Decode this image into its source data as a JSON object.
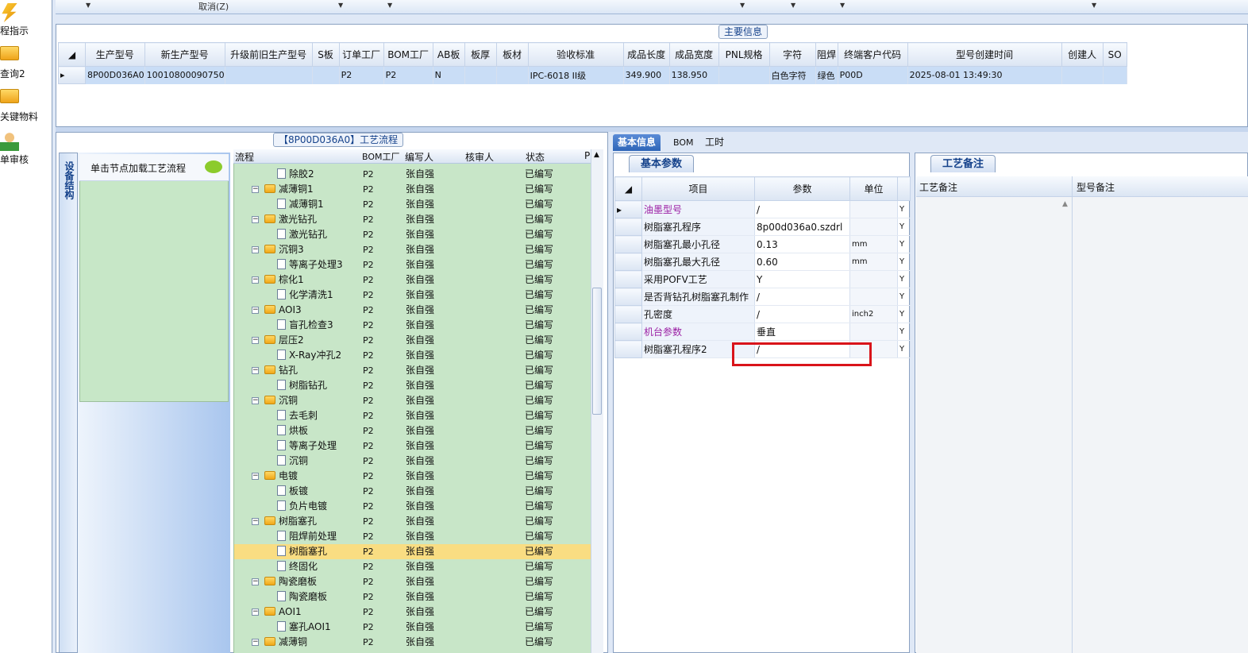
{
  "left_nav": [
    {
      "label": "程指示",
      "icon": "lightning-icon"
    },
    {
      "label": "查询2",
      "icon": "folder-open-icon"
    },
    {
      "label": "关键物料",
      "icon": "folder-open-icon"
    },
    {
      "label": "单审核",
      "icon": "user-icon"
    }
  ],
  "toolbar": {
    "cancel_label": "取消(Z)"
  },
  "main_info": {
    "legend": "主要信息",
    "columns": [
      "生产型号",
      "新生产型号",
      "升级前旧生产型号",
      "S板",
      "订单工厂",
      "BOM工厂",
      "AB板",
      "板厚",
      "板材",
      "验收标准",
      "成品长度",
      "成品宽度",
      "PNL规格",
      "字符",
      "阻焊",
      "终端客户代码",
      "型号创建时间",
      "创建人",
      "SO"
    ],
    "row": [
      "8P00D036A0",
      "10010800090750",
      "",
      "",
      "P2",
      "P2",
      "N",
      "",
      "",
      "IPC-6018 II级",
      "349.900",
      "138.950",
      "",
      "白色字符",
      "绿色",
      "P00D",
      "2025-08-01 13:49:30",
      "",
      ""
    ]
  },
  "process": {
    "legend": "【8P00D036A0】工艺流程",
    "side_tab": "设备结构",
    "node_hint": "单击节点加载工艺流程",
    "columns": [
      "流程",
      "BOM工厂",
      "编写人",
      "核审人",
      "状态",
      "P"
    ],
    "rows": [
      {
        "name": "除胶2",
        "level": 2,
        "factory": "P2",
        "writer": "张自强",
        "status": "已编写"
      },
      {
        "name": "减薄铜1",
        "level": 1,
        "factory": "P2",
        "writer": "张自强",
        "status": "已编写"
      },
      {
        "name": "减薄铜1",
        "level": 2,
        "factory": "P2",
        "writer": "张自强",
        "status": "已编写"
      },
      {
        "name": "激光钻孔",
        "level": 1,
        "factory": "P2",
        "writer": "张自强",
        "status": "已编写"
      },
      {
        "name": "激光钻孔",
        "level": 2,
        "factory": "P2",
        "writer": "张自强",
        "status": "已编写"
      },
      {
        "name": "沉铜3",
        "level": 1,
        "factory": "P2",
        "writer": "张自强",
        "status": "已编写"
      },
      {
        "name": "等离子处理3",
        "level": 2,
        "factory": "P2",
        "writer": "张自强",
        "status": "已编写"
      },
      {
        "name": "棕化1",
        "level": 1,
        "factory": "P2",
        "writer": "张自强",
        "status": "已编写"
      },
      {
        "name": "化学清洗1",
        "level": 2,
        "factory": "P2",
        "writer": "张自强",
        "status": "已编写"
      },
      {
        "name": "AOI3",
        "level": 1,
        "factory": "P2",
        "writer": "张自强",
        "status": "已编写"
      },
      {
        "name": "盲孔检查3",
        "level": 2,
        "factory": "P2",
        "writer": "张自强",
        "status": "已编写"
      },
      {
        "name": "层压2",
        "level": 1,
        "factory": "P2",
        "writer": "张自强",
        "status": "已编写"
      },
      {
        "name": "X-Ray冲孔2",
        "level": 2,
        "factory": "P2",
        "writer": "张自强",
        "status": "已编写"
      },
      {
        "name": "钻孔",
        "level": 1,
        "factory": "P2",
        "writer": "张自强",
        "status": "已编写"
      },
      {
        "name": "树脂钻孔",
        "level": 2,
        "factory": "P2",
        "writer": "张自强",
        "status": "已编写"
      },
      {
        "name": "沉铜",
        "level": 1,
        "factory": "P2",
        "writer": "张自强",
        "status": "已编写"
      },
      {
        "name": "去毛刺",
        "level": 2,
        "factory": "P2",
        "writer": "张自强",
        "status": "已编写"
      },
      {
        "name": "烘板",
        "level": 2,
        "factory": "P2",
        "writer": "张自强",
        "status": "已编写"
      },
      {
        "name": "等离子处理",
        "level": 2,
        "factory": "P2",
        "writer": "张自强",
        "status": "已编写"
      },
      {
        "name": "沉铜",
        "level": 2,
        "factory": "P2",
        "writer": "张自强",
        "status": "已编写"
      },
      {
        "name": "电镀",
        "level": 1,
        "factory": "P2",
        "writer": "张自强",
        "status": "已编写"
      },
      {
        "name": "板镀",
        "level": 2,
        "factory": "P2",
        "writer": "张自强",
        "status": "已编写"
      },
      {
        "name": "负片电镀",
        "level": 2,
        "factory": "P2",
        "writer": "张自强",
        "status": "已编写"
      },
      {
        "name": "树脂塞孔",
        "level": 1,
        "factory": "P2",
        "writer": "张自强",
        "status": "已编写"
      },
      {
        "name": "阻焊前处理",
        "level": 2,
        "factory": "P2",
        "writer": "张自强",
        "status": "已编写"
      },
      {
        "name": "树脂塞孔",
        "level": 2,
        "factory": "P2",
        "writer": "张自强",
        "status": "已编写",
        "selected": true
      },
      {
        "name": "终固化",
        "level": 2,
        "factory": "P2",
        "writer": "张自强",
        "status": "已编写"
      },
      {
        "name": "陶瓷磨板",
        "level": 1,
        "factory": "P2",
        "writer": "张自强",
        "status": "已编写"
      },
      {
        "name": "陶瓷磨板",
        "level": 2,
        "factory": "P2",
        "writer": "张自强",
        "status": "已编写"
      },
      {
        "name": "AOI1",
        "level": 1,
        "factory": "P2",
        "writer": "张自强",
        "status": "已编写"
      },
      {
        "name": "塞孔AOI1",
        "level": 2,
        "factory": "P2",
        "writer": "张自强",
        "status": "已编写"
      },
      {
        "name": "减薄铜",
        "level": 1,
        "factory": "P2",
        "writer": "张自强",
        "status": "已编写"
      }
    ]
  },
  "right_tabs": [
    "基本信息",
    "BOM",
    "工时"
  ],
  "basic_params": {
    "tab": "基本参数",
    "columns": [
      "项目",
      "参数",
      "单位"
    ],
    "rows": [
      {
        "item": "油墨型号",
        "value": "/",
        "unit": "",
        "flag": "Y",
        "highlight": true
      },
      {
        "item": "树脂塞孔程序",
        "value": "8p00d036a0.szdrl",
        "unit": "",
        "flag": "Y"
      },
      {
        "item": "树脂塞孔最小孔径",
        "value": "0.13",
        "unit": "mm",
        "flag": "Y"
      },
      {
        "item": "树脂塞孔最大孔径",
        "value": "0.60",
        "unit": "mm",
        "flag": "Y"
      },
      {
        "item": "采用POFV工艺",
        "value": "Y",
        "unit": "",
        "flag": "Y"
      },
      {
        "item": "是否背钻孔树脂塞孔制作",
        "value": "/",
        "unit": "",
        "flag": "Y"
      },
      {
        "item": "孔密度",
        "value": "/",
        "unit": "inch2",
        "flag": "Y"
      },
      {
        "item": "机台参数",
        "value": "垂直",
        "unit": "",
        "flag": "Y",
        "highlight": true
      },
      {
        "item": "树脂塞孔程序2",
        "value": "/",
        "unit": "",
        "flag": "Y"
      }
    ]
  },
  "remarks": {
    "tab": "工艺备注",
    "columns": [
      "工艺备注",
      "型号备注"
    ]
  }
}
